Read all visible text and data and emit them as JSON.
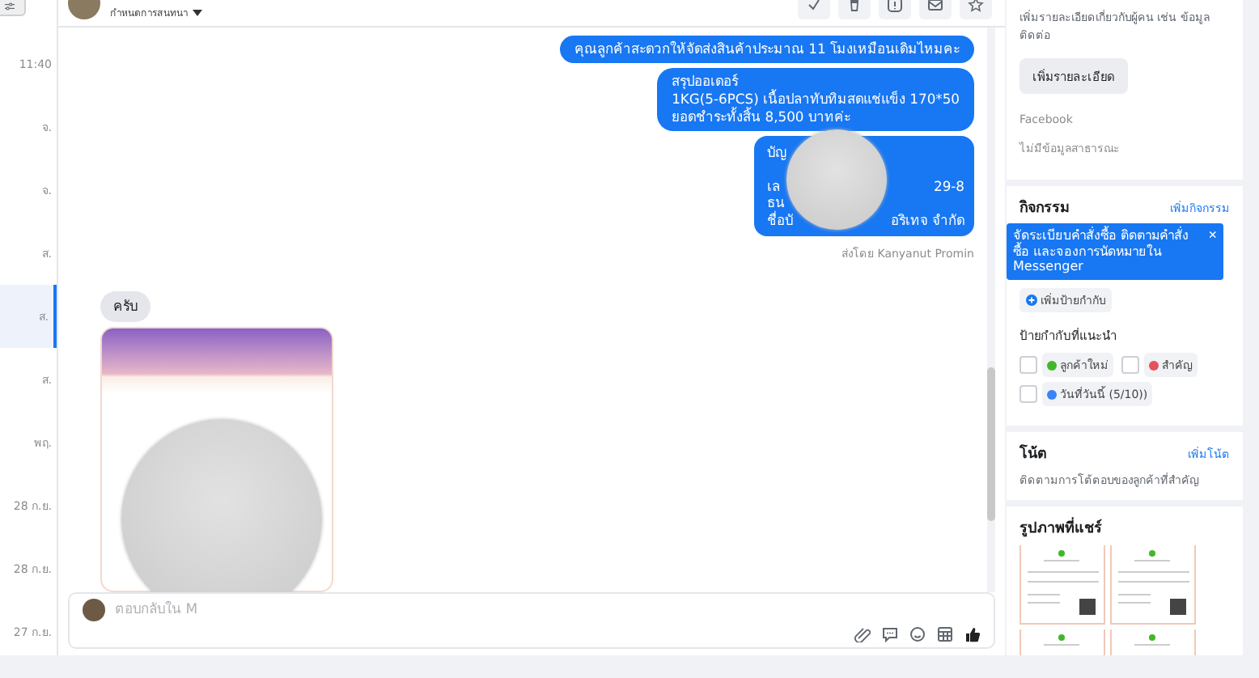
{
  "sidebar": {
    "time_labels": [
      {
        "text": "11:40",
        "selected": false
      },
      {
        "text": "จ.",
        "selected": false
      },
      {
        "text": "จ.",
        "selected": false
      },
      {
        "text": "ส.",
        "selected": false
      },
      {
        "text": "ส.",
        "selected": true
      },
      {
        "text": "ส.",
        "selected": false
      },
      {
        "text": "พฤ.",
        "selected": false
      },
      {
        "text": "28 ก.ย.",
        "selected": false
      },
      {
        "text": "28 ก.ย.",
        "selected": false
      },
      {
        "text": "27 ก.ย.",
        "selected": false
      }
    ]
  },
  "conversation": {
    "subtitle": "กำหนดการสนทนา",
    "actions": [
      {
        "kind": "check"
      },
      {
        "kind": "trash"
      },
      {
        "kind": "alert"
      },
      {
        "kind": "mail"
      },
      {
        "kind": "star"
      }
    ],
    "messages": [
      {
        "kind": "outgoing",
        "lines": [
          "คุณลูกค้าสะดวกให้จัดส่งสินค้าประมาณ 11 โมงเหมือนเดิมไหมคะ"
        ]
      },
      {
        "kind": "outgoing",
        "lines": [
          "สรุปออเดอร์",
          "1KG(5-6PCS) เนื้อปลาทับทิมสดแช่แข็ง 170*50",
          "ยอดชำระทั้งสิ้น 8,500 บาทค่ะ"
        ]
      },
      {
        "kind": "redacted",
        "rows": [
          {
            "left": "บัญ"
          },
          {
            "left": "เล",
            "right": "29-8"
          },
          {
            "left": "ธน"
          },
          {
            "left": "ชื่อบั",
            "right": "อริเทจ จำกัด"
          }
        ]
      },
      {
        "kind": "sent_by",
        "text": "ส่งโดย Kanyanut Promin"
      },
      {
        "kind": "incoming",
        "lines": [
          "ครับ"
        ]
      },
      {
        "kind": "image"
      }
    ],
    "composer": {
      "placeholder": "ตอบกลับใน M"
    }
  },
  "panel": {
    "details": {
      "hint": "เพิ่มรายละเอียดเกี่ยวกับผู้คน เช่น ข้อมูลติดต่อ",
      "button": "เพิ่มรายละเอียด",
      "source": "Facebook",
      "source_note": "ไม่มีข้อมูลสาธารณะ"
    },
    "activity": {
      "title": "กิจกรรม",
      "link": "เพิ่มกิจกรรม",
      "tooltip": "จัดระเบียบคำสั่งซื้อ ติดตามคำสั่งซื้อ และจองการนัดหมายใน Messenger",
      "tooltip_close": "×",
      "add_label": "เพิ่มป้ายกำกับ",
      "suggested_title": "ป้ายกำกับที่แนะนำ",
      "tags": [
        {
          "text": "ลูกค้าใหม่",
          "color": "#42b72a",
          "checked": false
        },
        {
          "text": "สำคัญ",
          "color": "#e8505b",
          "checked": false
        },
        {
          "text": "วันที่วันนี้ (5/10))",
          "color": "#3b82f6",
          "checked": false
        }
      ]
    },
    "notes": {
      "title": "โน้ต",
      "link": "เพิ่มโน้ต",
      "hint": "ติดตามการโต้ตอบของลูกค้าที่สำคัญ"
    },
    "shared": {
      "title": "รูปภาพที่แชร์",
      "images": [
        {
          "kind": "receipt"
        },
        {
          "kind": "receipt"
        },
        {
          "kind": "receipt"
        },
        {
          "kind": "receipt"
        }
      ]
    }
  }
}
